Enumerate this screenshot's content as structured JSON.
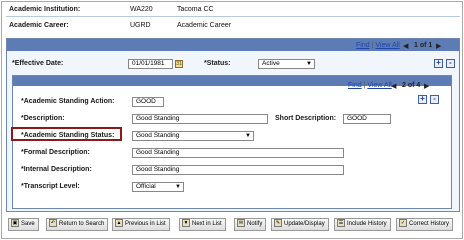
{
  "header": {
    "institution_label": "Academic Institution:",
    "institution_code": "WA220",
    "institution_name": "Tacoma CC",
    "career_label": "Academic Career:",
    "career_code": "UGRD",
    "career_name": "Academic Career"
  },
  "outer_nav": {
    "find": "Find",
    "sep": "|",
    "view_all": "View All",
    "position": "1 of 1"
  },
  "effective": {
    "date_label": "*Effective Date:",
    "date_value": "01/01/1981",
    "status_label": "*Status:",
    "status_value": "Active"
  },
  "inner_nav": {
    "find": "Find",
    "sep": "|",
    "view_all": "View All",
    "position": "2 of 4"
  },
  "standing": {
    "action_label": "*Academic Standing Action:",
    "action_value": "GOOD",
    "description_label": "*Description:",
    "description_value": "Good Standing",
    "short_label": "Short Description:",
    "short_value": "GOOD",
    "status_label": "*Academic Standing Status:",
    "status_value": "Good Standing",
    "formal_label": "*Formal Description:",
    "formal_value": "Good Standing",
    "internal_label": "*Internal Description:",
    "internal_value": "Good Standing",
    "transcript_label": "*Transcript Level:",
    "transcript_value": "Official"
  },
  "toolbar": {
    "save": "Save",
    "return": "Return to Search",
    "prev": "Previous in List",
    "next": "Next in List",
    "notify": "Notify",
    "update": "Update/Display",
    "include": "Include History",
    "correct": "Correct History"
  },
  "icons": {
    "add": "+",
    "remove": "-",
    "calendar": "calendar-icon"
  },
  "colors": {
    "panel_header": "#5d7bb4",
    "panel_border": "#6d87b3",
    "highlight_border": "#8b1a1a",
    "link": "#1f45a8"
  }
}
